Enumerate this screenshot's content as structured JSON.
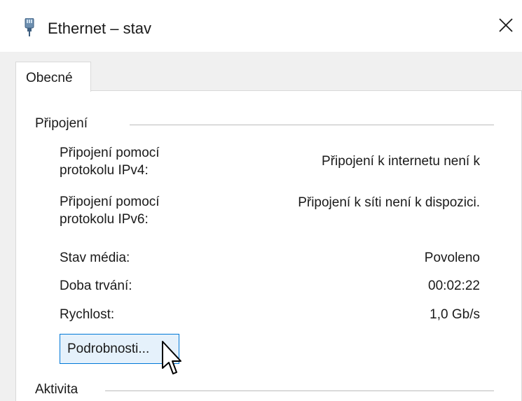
{
  "window": {
    "title": "Ethernet – stav",
    "close_icon": "close-x-icon",
    "title_icon": "ethernet-plug-icon"
  },
  "tabs": [
    {
      "label": "Obecné",
      "selected": true
    }
  ],
  "connection_group": {
    "title": "Připojení",
    "rows": [
      {
        "label_line1": "Připojení pomocí",
        "label_line2": "protokolu IPv4:",
        "value": "Připojení k internetu není k"
      },
      {
        "label_line1": "Připojení pomocí",
        "label_line2": "protokolu IPv6:",
        "value": "Připojení k síti není k dispozici."
      },
      {
        "label": "Stav média:",
        "value": "Povoleno"
      },
      {
        "label": "Doba trvání:",
        "value": "00:02:22"
      },
      {
        "label": "Rychlost:",
        "value": "1,0 Gb/s"
      }
    ],
    "details_button": "Podrobnosti..."
  },
  "activity_group": {
    "title": "Aktivita"
  },
  "colors": {
    "accent": "#0078d7",
    "button_bg": "#e5f1fb"
  }
}
